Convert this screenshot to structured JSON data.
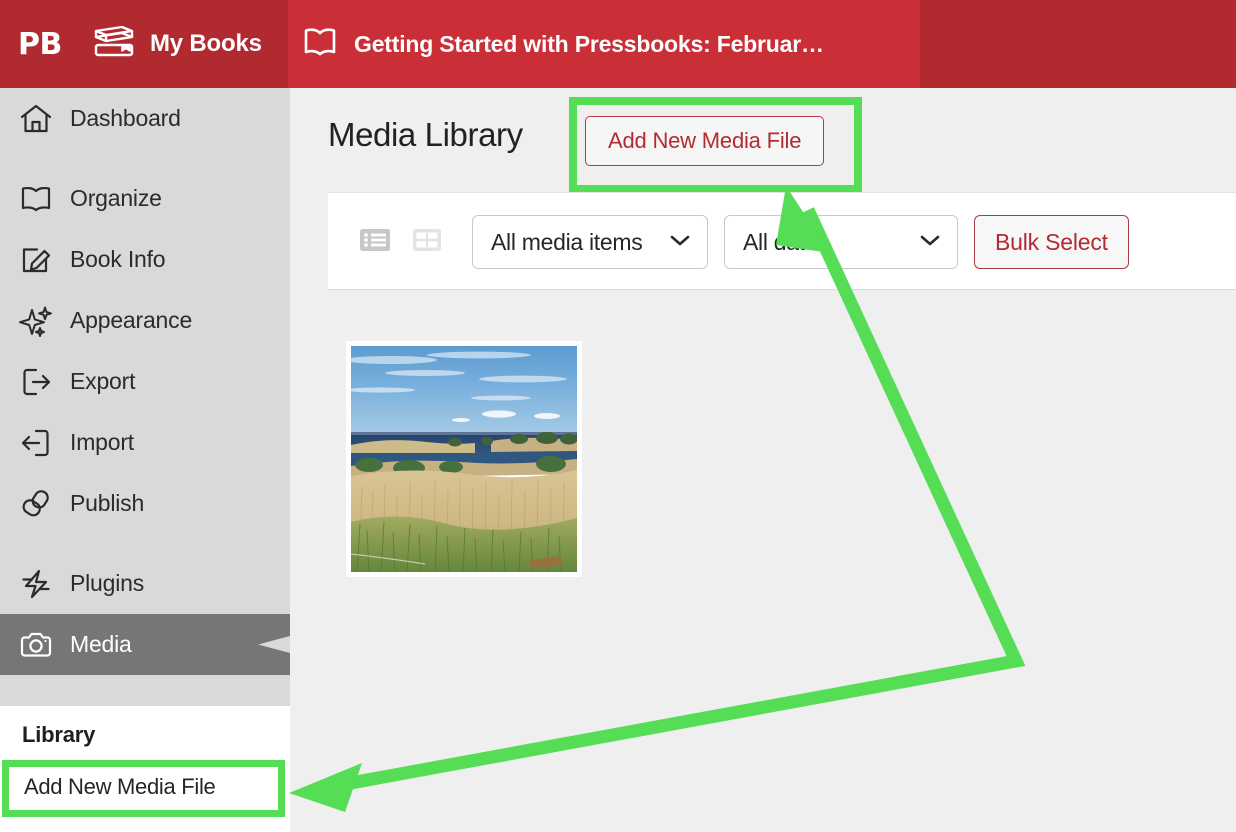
{
  "topbar": {
    "logo_text": "PB",
    "logo_icon": "pressbooks-logo",
    "my_books_label": "My Books",
    "my_books_icon": "books-stack-icon",
    "book_title": "Getting Started with Pressbooks: Februar…",
    "book_icon": "open-book-icon",
    "bg_color_dark": "#b02a30",
    "bg_color_bright": "#ca2f37"
  },
  "sidebar": {
    "items": [
      {
        "label": "Dashboard",
        "icon": "home-icon",
        "active": false
      },
      {
        "label": "Organize",
        "icon": "open-book-icon",
        "active": false
      },
      {
        "label": "Book Info",
        "icon": "pencil-edit-icon",
        "active": false
      },
      {
        "label": "Appearance",
        "icon": "sparkles-icon",
        "active": false
      },
      {
        "label": "Export",
        "icon": "export-icon",
        "active": false
      },
      {
        "label": "Import",
        "icon": "import-icon",
        "active": false
      },
      {
        "label": "Publish",
        "icon": "link-chain-icon",
        "active": false
      },
      {
        "label": "Plugins",
        "icon": "lightning-icon",
        "active": false
      },
      {
        "label": "Media",
        "icon": "camera-icon",
        "active": true
      }
    ],
    "submenu": {
      "heading": "Library",
      "item_label": "Add New Media File",
      "item_highlighted": true
    },
    "bg_color": "#d9d9d9",
    "active_bg_color": "#767676"
  },
  "main": {
    "page_title": "Media Library",
    "add_new_button": "Add New Media File",
    "add_new_highlighted": true,
    "toolbar": {
      "list_view_icon": "list-view-icon",
      "grid_view_icon": "grid-view-icon",
      "media_filter": "All media items",
      "dates_filter": "All dates",
      "chevron_icon": "chevron-down-icon",
      "bulk_select_label": "Bulk Select"
    },
    "media_items": [
      {
        "name": "marsh-landscape-photo",
        "alt": "Wetland marsh with tall golden reeds, blue water and blue sky"
      }
    ]
  },
  "annotations": {
    "highlight_color": "#55dd55",
    "arrow_color": "#55dd55",
    "arrow_targets": [
      "add-new-media-file-button",
      "sidebar-add-new-media-file"
    ]
  }
}
